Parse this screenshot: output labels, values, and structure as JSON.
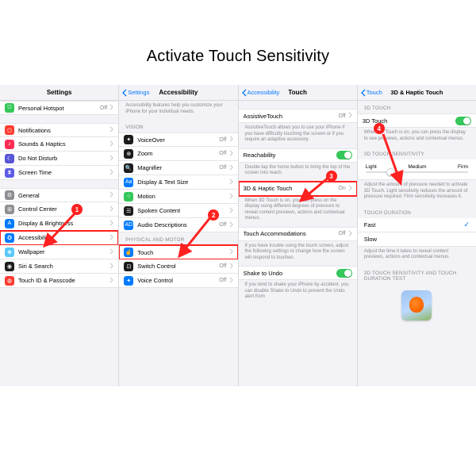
{
  "page_title": "Activate Touch Sensitivity",
  "panel1": {
    "header": "Settings",
    "items": [
      {
        "label": "Personal Hotspot",
        "value": "Off",
        "icon": "ic-green"
      },
      {
        "label": "Notifications",
        "icon": "ic-red"
      },
      {
        "label": "Sounds & Haptics",
        "icon": "ic-pink"
      },
      {
        "label": "Do Not Disturb",
        "icon": "ic-purple"
      },
      {
        "label": "Screen Time",
        "icon": "ic-indigo"
      },
      {
        "label": "General",
        "icon": "ic-gray"
      },
      {
        "label": "Control Center",
        "icon": "ic-gray"
      },
      {
        "label": "Display & Brightness",
        "icon": "ic-blue"
      },
      {
        "label": "Accessibility",
        "icon": "ic-blue"
      },
      {
        "label": "Wallpaper",
        "icon": "ic-teal"
      },
      {
        "label": "Siri & Search",
        "icon": "ic-black"
      },
      {
        "label": "Touch ID & Passcode",
        "icon": "ic-red"
      }
    ]
  },
  "panel2": {
    "back": "Settings",
    "title": "Accessibility",
    "intro": "Accessibility features help you customize your iPhone for your individual needs.",
    "section_vision": "VISION",
    "vision_items": [
      {
        "label": "VoiceOver",
        "value": "Off",
        "icon": "ic-black"
      },
      {
        "label": "Zoom",
        "value": "Off",
        "icon": "ic-black"
      },
      {
        "label": "Magnifier",
        "value": "Off",
        "icon": "ic-black"
      },
      {
        "label": "Display & Text Size",
        "icon": "ic-blue"
      },
      {
        "label": "Motion",
        "icon": "ic-green"
      },
      {
        "label": "Spoken Content",
        "icon": "ic-black"
      },
      {
        "label": "Audio Descriptions",
        "value": "Off",
        "icon": "ic-blue"
      }
    ],
    "section_motor": "PHYSICAL AND MOTOR",
    "motor_items": [
      {
        "label": "Touch",
        "icon": "ic-blue"
      },
      {
        "label": "Switch Control",
        "value": "Off",
        "icon": "ic-black"
      },
      {
        "label": "Voice Control",
        "value": "Off",
        "icon": "ic-blue"
      }
    ]
  },
  "panel3": {
    "back": "Accessibility",
    "title": "Touch",
    "assistive": {
      "label": "AssistiveTouch",
      "value": "Off",
      "desc": "AssistiveTouch allows you to use your iPhone if you have difficulty touching the screen or if you require an adaptive accessory."
    },
    "reach": {
      "label": "Reachability",
      "desc": "Double-tap the home button to bring the top of the screen into reach."
    },
    "haptic": {
      "label": "3D & Haptic Touch",
      "value": "On",
      "desc": "When 3D Touch is on, you can press on the display using different degrees of pressure to reveal content previews, actions and contextual menus."
    },
    "accom": {
      "label": "Touch Accommodations",
      "value": "Off",
      "desc": "If you have trouble using the touch screen, adjust the following settings to change how the screen will respond to touches."
    },
    "shake": {
      "label": "Shake to Undo",
      "desc": "If you tend to shake your iPhone by accident, you can disable Shake to Undo to prevent the Undo alert from"
    }
  },
  "panel4": {
    "back": "Touch",
    "title": "3D & Haptic Touch",
    "three_d": {
      "section": "3D TOUCH",
      "label": "3D Touch",
      "desc": "When 3D Touch is on, you can press the display to see previews, actions and contextual menus."
    },
    "sens": {
      "section": "3D TOUCH SENSITIVITY",
      "light": "Light",
      "medium": "Medium",
      "firm": "Firm",
      "desc": "Adjust the amount of pressure needed to activate 3D Touch. Light sensitivity reduces the amount of pressure required. Firm sensitivity increases it."
    },
    "dur": {
      "section": "TOUCH DURATION",
      "fast": "Fast",
      "slow": "Slow",
      "desc": "Adjust the time it takes to reveal content previews, actions and contextual menus."
    },
    "test": "3D TOUCH SENSITIVITY AND TOUCH DURATION TEST"
  },
  "callouts": {
    "1": "1",
    "2": "2",
    "3": "3",
    "4": "4"
  }
}
